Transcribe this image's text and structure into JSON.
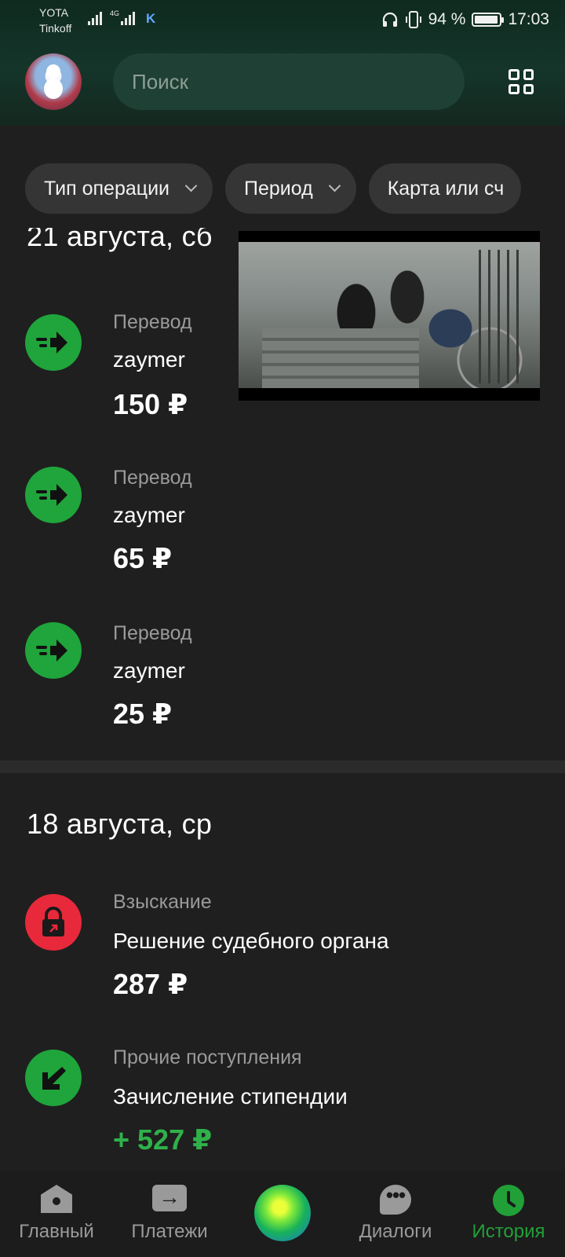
{
  "status_bar": {
    "carrier_1": "YOTA",
    "carrier_2": "Tinkoff",
    "network": "4G",
    "app_badge": "K",
    "battery": "94 %",
    "battery_level": 0.94,
    "time": "17:03"
  },
  "header": {
    "search_placeholder": "Поиск"
  },
  "filters": [
    {
      "label": "Тип операции"
    },
    {
      "label": "Период"
    },
    {
      "label": "Карта или сч"
    }
  ],
  "sections": [
    {
      "date": "21 августа, сб",
      "operations": [
        {
          "category": "Перевод",
          "name": "zaymer",
          "amount": "150 ₽",
          "icon": "arrow-right-icon"
        },
        {
          "category": "Перевод",
          "name": "zaymer",
          "amount": "65 ₽",
          "icon": "arrow-right-icon"
        },
        {
          "category": "Перевод",
          "name": "zaymer",
          "amount": "25 ₽",
          "icon": "arrow-right-icon"
        }
      ]
    },
    {
      "date": "18 августа, ср",
      "operations": [
        {
          "category": "Взыскание",
          "name": "Решение судебного органа",
          "amount": "287 ₽",
          "icon": "lock-icon"
        },
        {
          "category": "Прочие поступления",
          "name": "Зачисление стипендии",
          "amount": "+ 527 ₽",
          "icon": "arrow-down-left-icon"
        }
      ]
    }
  ],
  "bottom_nav": [
    {
      "label": "Главный",
      "icon": "home-icon"
    },
    {
      "label": "Платежи",
      "icon": "payments-icon"
    },
    {
      "label": "",
      "icon": "sber-assistant-icon"
    },
    {
      "label": "Диалоги",
      "icon": "chat-icon"
    },
    {
      "label": "История",
      "icon": "clock-icon",
      "active": true
    }
  ],
  "colors": {
    "accent": "#21a038",
    "income": "#2fb14a",
    "debit_red": "#e8293b",
    "background": "#1f1f1f",
    "header": "#15352a"
  }
}
